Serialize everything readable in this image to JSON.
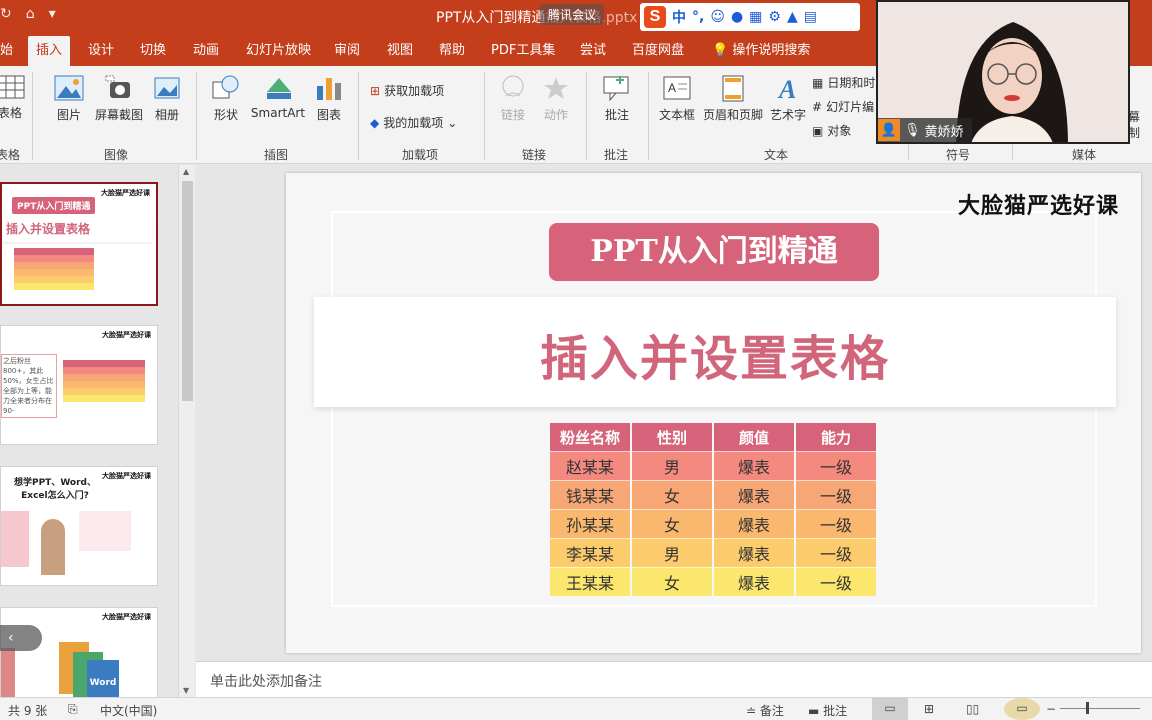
{
  "window": {
    "title": "PPT从入门到精通",
    "title_suffix": "插入表格.pptx",
    "meeting_badge": "腾讯会议"
  },
  "ime": {
    "logo": "S",
    "mode": "中",
    "punct": "°,"
  },
  "tabs": [
    "始",
    "插入",
    "设计",
    "切换",
    "动画",
    "幻灯片放映",
    "审阅",
    "视图",
    "帮助",
    "PDF工具集",
    "尝试",
    "百度网盘",
    "操作说明搜索"
  ],
  "ribbon": {
    "table": {
      "label": "表格",
      "group": "表格"
    },
    "images": {
      "items": [
        "图片",
        "屏幕截图",
        "相册"
      ],
      "group": "图像"
    },
    "illustrations": {
      "items": [
        "形状",
        "SmartArt",
        "图表"
      ],
      "group": "插图"
    },
    "addins": {
      "get": "获取加载项",
      "mine": "我的加载项",
      "group": "加载项"
    },
    "links": {
      "items": [
        "链接",
        "动作"
      ],
      "group": "链接"
    },
    "comments": {
      "item": "批注",
      "group": "批注"
    },
    "text": {
      "items": [
        "文本框",
        "页眉和页脚",
        "艺术字"
      ],
      "small": [
        "日期和时",
        "幻灯片编",
        "对象"
      ],
      "group": "文本"
    },
    "symbols": {
      "group": "符号"
    },
    "media": {
      "group": "媒体",
      "partial": [
        "幕",
        "制"
      ]
    }
  },
  "webcam": {
    "participant": "黄娇娇"
  },
  "thumbnails": [
    {
      "brand": "大脸猫严选好课",
      "pill": "PPT从入门到精通",
      "title": "插入并设置表格"
    },
    {
      "brand": "大脸猫严选好课",
      "text": "之后粉丝800+，其此 50%，女生占比全部为上等，能力全来者分布在90-"
    },
    {
      "brand": "大脸猫严选好课",
      "title": "想学PPT、Word、Excel怎么入门?"
    },
    {
      "brand": "大脸猫严选好课",
      "word": "Word"
    }
  ],
  "slide": {
    "brand": "大脸猫严选好课",
    "pill_title": "PPT从入门到精通",
    "main_title": "插入并设置表格",
    "table": {
      "headers": [
        "粉丝名称",
        "性别",
        "颜值",
        "能力"
      ],
      "rows": [
        [
          "赵某某",
          "男",
          "爆表",
          "一级"
        ],
        [
          "钱某某",
          "女",
          "爆表",
          "一级"
        ],
        [
          "孙某某",
          "女",
          "爆表",
          "一级"
        ],
        [
          "李某某",
          "男",
          "爆表",
          "一级"
        ],
        [
          "王某某",
          "女",
          "爆表",
          "一级"
        ]
      ],
      "row_colors": [
        "#f48a7f",
        "#f7a676",
        "#fab86e",
        "#fccc6c",
        "#fbe66e"
      ],
      "header_color": "#d6637a"
    }
  },
  "notes": {
    "placeholder": "单击此处添加备注"
  },
  "status": {
    "slides": "共 9 张",
    "language": "中文(中国)",
    "notes_btn": "备注",
    "comments_btn": "批注"
  }
}
